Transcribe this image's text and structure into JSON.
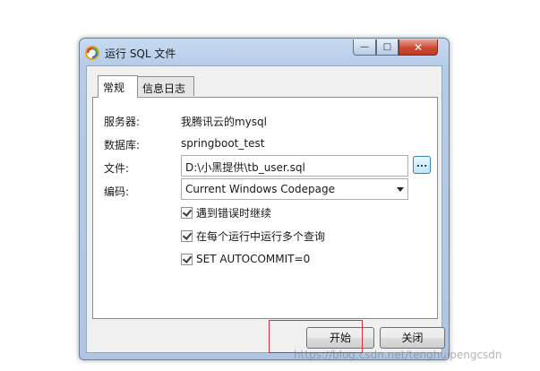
{
  "window": {
    "title": "运行 SQL 文件",
    "controls": {
      "minimize": "—",
      "maximize": "□",
      "close": "✕"
    }
  },
  "tabs": [
    {
      "label": "常规",
      "active": true
    },
    {
      "label": "信息日志",
      "active": false
    }
  ],
  "form": {
    "server_label": "服务器:",
    "server_value": "我腾讯云的mysql",
    "database_label": "数据库:",
    "database_value": "springboot_test",
    "file_label": "文件:",
    "file_value": "D:\\小黑提供\\tb_user.sql",
    "browse_label": "...",
    "encoding_label": "编码:",
    "encoding_value": "Current Windows Codepage"
  },
  "options": [
    {
      "label": "遇到错误时继续",
      "checked": true
    },
    {
      "label": "在每个运行中运行多个查询",
      "checked": true
    },
    {
      "label": "SET AUTOCOMMIT=0",
      "checked": true
    }
  ],
  "buttons": {
    "start": "开始",
    "close": "关闭"
  },
  "watermark": "https://blog.csdn.net/tenghuipengcsdn",
  "colors": {
    "highlight": "#d9303a",
    "close_button": "#c94a33"
  },
  "icons": {
    "app": "navicat-logo-icon",
    "dropdown": "chevron-down-icon"
  }
}
